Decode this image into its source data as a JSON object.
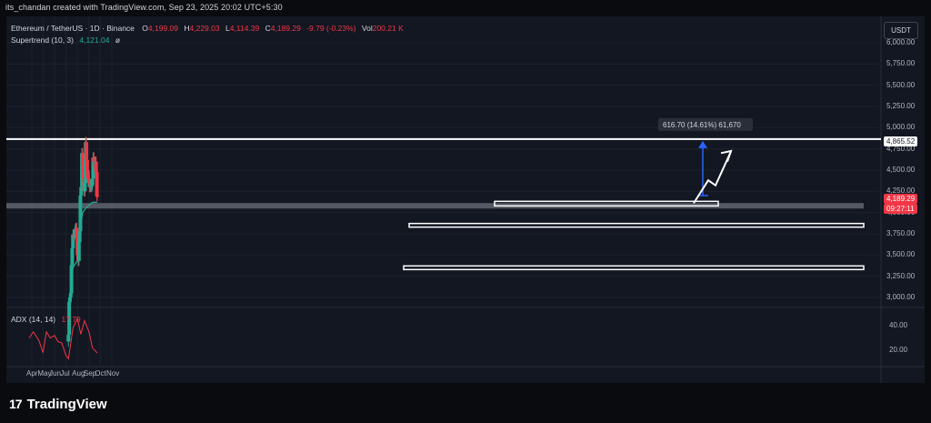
{
  "header": {
    "author_line": "its_chandan created with TradingView.com, Sep 23, 2025 20:02 UTC+5:30"
  },
  "legend": {
    "symbol": "Ethereum / TetherUS · 1D · Binance",
    "open_label": "O",
    "open": "4,199.09",
    "high_label": "H",
    "high": "4,229.03",
    "low_label": "L",
    "low": "4,114.39",
    "close_label": "C",
    "close": "4,189.29",
    "change": "-9.79 (-0.23%)",
    "vol_label": "Vol",
    "vol": "200.21 K",
    "supertrend_label": "Supertrend (10, 3)",
    "supertrend_value": "4,121.04",
    "supertrend_extra": "ø"
  },
  "adx": {
    "label": "ADX (14, 14)",
    "value": "17.79"
  },
  "currency_button": "USDT",
  "price_axis": [
    "6,000.00",
    "5,750.00",
    "5,500.00",
    "5,250.00",
    "5,000.00",
    "4,750.00",
    "4,500.00",
    "4,250.00",
    "4,000.00",
    "3,750.00",
    "3,500.00",
    "3,250.00",
    "3,000.00"
  ],
  "adx_axis": [
    "40.00",
    "20.00"
  ],
  "time_axis": [
    "Apr",
    "May",
    "Jun",
    "Jul",
    "Aug",
    "Sep",
    "Oct",
    "Nov"
  ],
  "tags": {
    "resistance": "4,865.52",
    "last_price": "4,189.29",
    "countdown": "09:27:11"
  },
  "measure_label": "616.70 (14.61%) 61,670",
  "brand": {
    "name": "TradingView",
    "logo_glyph": "17"
  },
  "colors": {
    "up": "#22ab94",
    "down": "#f23645",
    "background": "#131722",
    "adx_line": "#f23645",
    "measure": "#2962ff"
  },
  "chart_data": {
    "type": "line",
    "series": [
      {
        "name": "Ethereum / TetherUS · 1D · Binance",
        "kind": "candlestick",
        "points_close": [
          [
            "Jul 8",
            2560
          ],
          [
            "Jul 10",
            2950
          ],
          [
            "Jul 12",
            3000
          ],
          [
            "Jul 14",
            3050
          ],
          [
            "Jul 16",
            3380
          ],
          [
            "Jul 18",
            3580
          ],
          [
            "Jul 20",
            3740
          ],
          [
            "Jul 22",
            3720
          ],
          [
            "Jul 24",
            3750
          ],
          [
            "Jul 26",
            3800
          ],
          [
            "Jul 28",
            3820
          ],
          [
            "Jul 30",
            3720
          ],
          [
            "Aug 1",
            3500
          ],
          [
            "Aug 3",
            3430
          ],
          [
            "Aug 5",
            3650
          ],
          [
            "Aug 7",
            3780
          ],
          [
            "Aug 9",
            4200
          ],
          [
            "Aug 11",
            4300
          ],
          [
            "Aug 13",
            4700
          ],
          [
            "Aug 15",
            4550
          ],
          [
            "Aug 17",
            4400
          ],
          [
            "Aug 19",
            4250
          ],
          [
            "Aug 21",
            4350
          ],
          [
            "Aug 23",
            4830
          ],
          [
            "Aug 25",
            4620
          ],
          [
            "Aug 27",
            4500
          ],
          [
            "Aug 29",
            4400
          ],
          [
            "Aug 31",
            4380
          ],
          [
            "Sep 2",
            4300
          ],
          [
            "Sep 4",
            4330
          ],
          [
            "Sep 6",
            4300
          ],
          [
            "Sep 8",
            4320
          ],
          [
            "Sep 10",
            4400
          ],
          [
            "Sep 12",
            4650
          ],
          [
            "Sep 14",
            4600
          ],
          [
            "Sep 16",
            4550
          ],
          [
            "Sep 18",
            4600
          ],
          [
            "Sep 20",
            4480
          ],
          [
            "Sep 22",
            4200
          ],
          [
            "Sep 23",
            4189.29
          ]
        ]
      },
      {
        "name": "Supertrend (10, 3)",
        "points": [
          [
            "Jul 10",
            2700
          ],
          [
            "Jul 20",
            3350
          ],
          [
            "Jul 30",
            3420
          ],
          [
            "Aug 5",
            3430
          ],
          [
            "Aug 9",
            3820
          ],
          [
            "Aug 15",
            4000
          ],
          [
            "Aug 23",
            4050
          ],
          [
            "Sep 10",
            4121.04
          ],
          [
            "Sep 23",
            4121.04
          ]
        ]
      },
      {
        "name": "ADX (14, 14)",
        "points": [
          [
            "Mar 25",
            30
          ],
          [
            "Apr 5",
            35
          ],
          [
            "Apr 20",
            28
          ],
          [
            "May 1",
            18
          ],
          [
            "May 10",
            35
          ],
          [
            "May 20",
            30
          ],
          [
            "Jun 1",
            32
          ],
          [
            "Jun 10",
            27
          ],
          [
            "Jun 20",
            26
          ],
          [
            "Jul 1",
            16
          ],
          [
            "Jul 8",
            13
          ],
          [
            "Jul 20",
            38
          ],
          [
            "Aug 1",
            46
          ],
          [
            "Aug 10",
            33
          ],
          [
            "Aug 20",
            44
          ],
          [
            "Sep 1",
            35
          ],
          [
            "Sep 10",
            22
          ],
          [
            "Sep 23",
            17.79
          ]
        ]
      }
    ],
    "ylim": [
      2950,
      6200
    ],
    "annotations": {
      "resistance_level": 4865.52,
      "support_levels": [
        4100,
        3850,
        3350
      ],
      "measure": "616.70 (14.61%) 61,670"
    },
    "grid": true,
    "legend_placement": "top-left"
  }
}
